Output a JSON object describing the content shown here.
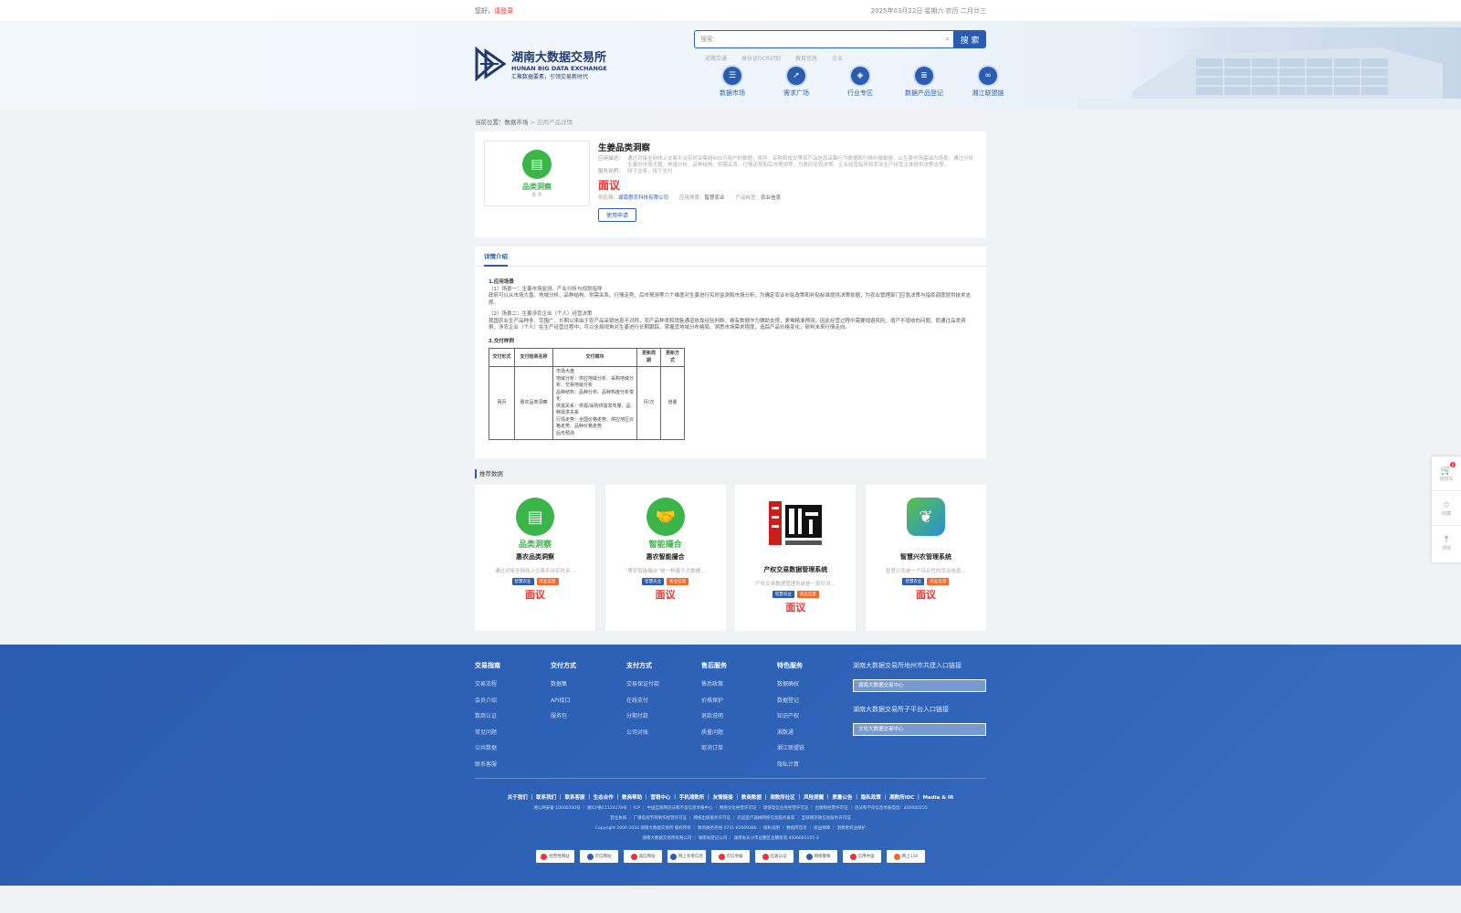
{
  "topbar": {
    "greeting": "您好，",
    "login": "请登录",
    "datetime": "2025年03月22日 星期六 农历 二月廿三"
  },
  "header": {
    "logo": {
      "cn": "湖南大数据交易所",
      "en": "HUNAN BIG DATA EXCHANGE",
      "slogan": "汇聚数据要素，引领交易新时代"
    },
    "search": {
      "placeholder": "搜索",
      "button": "搜 索"
    },
    "hot": [
      "道路交通",
      "身份证OCR识别",
      "教育信息",
      "企业"
    ],
    "nav": [
      {
        "label": "数据市场",
        "icon": "database-icon"
      },
      {
        "label": "需求广场",
        "icon": "compass-icon"
      },
      {
        "label": "行业专区",
        "icon": "cube-icon"
      },
      {
        "label": "数据产品登记",
        "icon": "stack-icon"
      },
      {
        "label": "湘江联盟链",
        "icon": "chain-icon"
      }
    ]
  },
  "breadcrumb": {
    "prefix": "当前位置：",
    "market": "数据市场",
    "sep": " > ",
    "current": "应用产品详情"
  },
  "product": {
    "image_caption": "品类洞察",
    "image_tiny": "惠 农",
    "title": "生姜品类洞察",
    "desc_label": "应用描述：",
    "desc": "通过对接全网线上交易平台实时采集超400万用户的数据，将所，采购和成交等农产品信息采集行为数据和行情价格数据，以生姜市场基础为场景，通过分析生姜的市场大盘、地域分析、品种结构、供需关系、行情走势和后市预测等，为政府宏观决策、企业经营指导和农业生产经营主体提供决策支撑。",
    "service_label": "服务说明：",
    "service": "线下交易，线下交付",
    "price": "面议",
    "supplier_label": "供应商：",
    "supplier": "湖南惠农科技有限公司",
    "scene_label": "应用场景：",
    "scene": "智慧农业",
    "tag_label": "产品标签：",
    "tag": "农业信息",
    "apply_button": "使用申请"
  },
  "detail": {
    "tab": "详情介绍",
    "s1_title": "1.应用场景",
    "s1_a_title": "（1）场景一：生姜市场监测、产业分析与规划指导",
    "s1_a_body": "政府可以从市场大盘、地域分析、品种结构、供需关系、行情走势、后市预测等六个维度对生姜进行实时监测和市场分析，为确定农业补贴政策和补贴标准提供决策依据，为农业管理部门应急决策与指挥调度提供技术支撑。",
    "s1_b_title": "（2）场景二：生姜涉农企业（个人）经营决策",
    "s1_b_body": "我国农业生产品种多、范围广，长期以来由于农产品采销信息不对称，农产品种类和销售通道依靠经验判断，难有数据作为辅助支撑，更难精准预测，因此经营过程中需要规避风险，增产不增收的问题。而通过品类洞察，涉农企业（个人）在生产经营过程中，可以全局视角对生姜进行长期跟踪，掌握其地域分布格局、洞悉市场需求程度，追踪产品价格变化，研判未来行情走向。",
    "s2_title": "2.交付样例",
    "table": {
      "headers": [
        "交付形式",
        "支付结果名称",
        "交付模块",
        "更新周期",
        "更新方式"
      ],
      "row": {
        "form": "网页",
        "name": "惠农品类洞察",
        "modules": [
          "市场大盘",
          "地域分析：供应地域分析、采购地域分析、交易地域分析",
          "品种结构：品种分布、品种热度分析变化",
          "供需关系：供需/采购供需发布量、品种需求关系",
          "行情走势：全国价格走势、供应地区价格走势、品种价格走势",
          "后市预测"
        ],
        "cycle": "月/次",
        "method": "增量"
      }
    }
  },
  "recommend": {
    "title": "推荐数据",
    "cards": [
      {
        "name": "惠农品类洞察",
        "caption": "品类洞察",
        "icon": "document-icon",
        "color": "#3bb54a",
        "desc": "通过对接全网线上交易平台实时采…",
        "tags": [
          "智慧农业",
          "农业信息"
        ],
        "price": "面议"
      },
      {
        "name": "惠农智能撮合",
        "caption": "智能撮合",
        "icon": "handshake-icon",
        "color": "#3bb54a",
        "desc": "“惠农智能撮合”是一种基于大数据…",
        "tags": [
          "智慧农业",
          "农业信息"
        ],
        "price": "面议"
      },
      {
        "name": "产权交易数据管理系统",
        "caption": "",
        "icon": "shengding-logo",
        "color": "#c81e1e",
        "desc": "产权交易数据管理系统是一款针对…",
        "tags": [
          "智慧农业",
          "农业信息"
        ],
        "price": "面议"
      },
      {
        "name": "智慧兴农管理系统",
        "caption": "",
        "icon": "leaf-icon",
        "color": "#2aa8a0",
        "desc": "智慧兴农是一个综合性的农业信息…",
        "tags": [
          "智慧农业",
          "农业信息"
        ],
        "price": "面议"
      }
    ]
  },
  "footer": {
    "cols": [
      {
        "title": "交易指南",
        "items": [
          "交易流程",
          "会员介绍",
          "数商认证",
          "常见问题",
          "公共数据",
          "联系客服"
        ]
      },
      {
        "title": "交付方式",
        "items": [
          "数据集",
          "API接口",
          "服务包"
        ]
      },
      {
        "title": "支付方式",
        "items": [
          "交易保证付款",
          "在线支付",
          "分期付款",
          "公司对账"
        ]
      },
      {
        "title": "售后服务",
        "items": [
          "售后政策",
          "价格保护",
          "退款说明",
          "质量问题",
          "取消订单"
        ]
      },
      {
        "title": "特色服务",
        "items": [
          "数据确权",
          "数据登记",
          "知识产权",
          "湘数通",
          "湘江联盟链",
          "隐私计算"
        ]
      }
    ],
    "entry1_title": "湖南大数据交易所地州市共建入口链接",
    "entry1_value": "湖南大数据交易中心",
    "entry2_title": "湖南大数据交易所子平台入口链接",
    "entry2_value": "文化大数据交易中心",
    "links": "关于我们 ｜ 联系我们 ｜ 联系客服 ｜ 生态合作 ｜ 数商帮助 ｜ 营销中心 ｜ 手机湘数所 ｜ 友情链接 ｜ 数商数据 ｜ 湘数所社区 ｜ 风险提醒 ｜ 质量公告 ｜ 隐私政策 ｜ 湘数所IDC ｜ Media & IR",
    "small1": "湘公网安备 10000200号 ｜ 湘ICP备11124178号 ｜ ICP ｜ 中国互联网违法和不良信息举报中心 ｜ 网络文化经营许可证 ｜ 增值电信业务经营许可证 ｜ 出版物经营许可证 ｜ 违法和不良信息举报电话：400000155",
    "small2": "营业执照 ｜ 广播电视节目制作经营许可证 ｜ 网络出版服务许可证 ｜ 药品医疗器械网络信息服务备案 ｜ 互联网宗教信息服务许可证",
    "small3": "Copyright 2000-2024 湖南大数据交易所 版权所有 ｜ 数商服务热线 0731-81669386 ｜ 隐私说明 ｜ 数据所首页 ｜ 权益保障 ｜ 消费者权益保护",
    "small4": "湖南大数据交易所有限公司 ｜ 湖南省登记公司 ｜ 湖南省长沙市岳麓区岳麓街道 4006661155-3",
    "badges": [
      "经营性网站",
      "可信网站",
      "诚信网站",
      "网上有害信息",
      "可信举报",
      "红盾认证",
      "网络警察",
      "信用中国",
      "网上110"
    ]
  },
  "sidebar": [
    {
      "label": "购物车",
      "icon": "cart-icon",
      "count": "0"
    },
    {
      "label": "收藏",
      "icon": "star-icon"
    },
    {
      "label": "顶部",
      "icon": "top-icon"
    }
  ]
}
